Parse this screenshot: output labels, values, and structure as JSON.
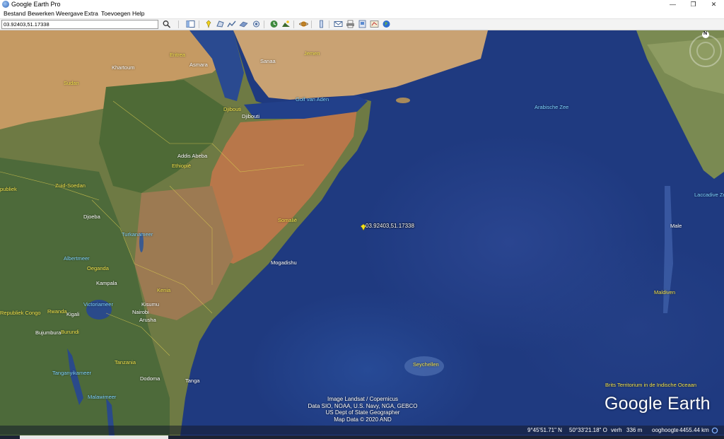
{
  "window": {
    "title": "Google Earth Pro",
    "minimize": "—",
    "maximize": "❐",
    "close": "✕"
  },
  "menu": [
    "Bestand",
    "Bewerken",
    "Weergave",
    "Extra",
    "Toevoegen",
    "Help"
  ],
  "search": {
    "value": "03.92403,51.17338"
  },
  "toolbar_icons": [
    "search-icon",
    "sidebar-toggle-icon",
    "placemark-icon",
    "polygon-icon",
    "path-icon",
    "image-overlay-icon",
    "record-tour-icon",
    "historical-imagery-icon",
    "sunlight-icon",
    "planets-icon",
    "ruler-icon",
    "email-icon",
    "print-icon",
    "save-image-icon",
    "view-in-maps-icon",
    "earth-icon"
  ],
  "map": {
    "placemark": {
      "label": "03.92403,51.17338"
    },
    "countries": [
      {
        "key": "sudan",
        "text": "Sudan"
      },
      {
        "key": "eritrea",
        "text": "Eritrea"
      },
      {
        "key": "jemen",
        "text": "Jemen"
      },
      {
        "key": "djibouti",
        "text": "Djibouti"
      },
      {
        "key": "ethiopie",
        "text": "Ethiopië"
      },
      {
        "key": "zuid_soedan",
        "text": "Zuid-Soedan"
      },
      {
        "key": "somalie",
        "text": "Somalië"
      },
      {
        "key": "oeganda",
        "text": "Oeganda"
      },
      {
        "key": "kenia",
        "text": "Kenia"
      },
      {
        "key": "rwanda",
        "text": "Rwanda"
      },
      {
        "key": "burundi",
        "text": "Burundi"
      },
      {
        "key": "tanzania",
        "text": "Tanzania"
      },
      {
        "key": "seychellen",
        "text": "Seychellen"
      },
      {
        "key": "malediven",
        "text": "Maldiven"
      },
      {
        "key": "rep_congo",
        "text": "Republiek Congo"
      },
      {
        "key": "zuid_left",
        "text": "publiek"
      }
    ],
    "cities": [
      {
        "key": "khartoum",
        "text": "Khartoum"
      },
      {
        "key": "asmara",
        "text": "Asmara"
      },
      {
        "key": "sanaa",
        "text": "Sanaa"
      },
      {
        "key": "djibouti_city",
        "text": "Djibouti"
      },
      {
        "key": "addis",
        "text": "Addis Abeba"
      },
      {
        "key": "juba",
        "text": "Djoeba"
      },
      {
        "key": "mogadishu",
        "text": "Mogadishu"
      },
      {
        "key": "kampala",
        "text": "Kampala"
      },
      {
        "key": "kigali",
        "text": "Kigali"
      },
      {
        "key": "nairobi",
        "text": "Nairobi"
      },
      {
        "key": "bujumbura",
        "text": "Bujumbura"
      },
      {
        "key": "dodoma",
        "text": "Dodoma"
      },
      {
        "key": "male",
        "text": "Male"
      },
      {
        "key": "kisumu",
        "text": "Kisumu"
      },
      {
        "key": "arusha",
        "text": "Arusha"
      },
      {
        "key": "tanga",
        "text": "Tanga"
      }
    ],
    "waters": [
      {
        "key": "golf_aden",
        "text": "Golf van Aden"
      },
      {
        "key": "arabische_zee",
        "text": "Arabische Zee"
      },
      {
        "key": "turkana",
        "text": "Turkanameer"
      },
      {
        "key": "victoria",
        "text": "Victoriameer"
      },
      {
        "key": "albert",
        "text": "Albertmeer"
      },
      {
        "key": "tanganyika",
        "text": "Tanganyikameer"
      },
      {
        "key": "malawi",
        "text": "Malawimeer"
      },
      {
        "key": "laccadive",
        "text": "Laccadive Zee"
      }
    ],
    "regions": [
      {
        "key": "biot",
        "text": "Brits Territorium in de Indische Oceaan"
      }
    ],
    "attribution": [
      "Image Landsat / Copernicus",
      "Data SIO, NOAA, U.S. Navy, NGA, GEBCO",
      "US Dept of State Geographer",
      "Map Data © 2020 AND"
    ],
    "logo": "Google Earth",
    "compass_letter": "N"
  },
  "status": {
    "lat": "9°45'51.71\" N",
    "lon": "50°33'21.18\" O",
    "elev_label": "verh",
    "elev": "336 m",
    "eye_label": "ooghoogte",
    "eye": "4455.44 km"
  },
  "colors": {
    "ocean": "#1f3a80",
    "land_desert": "#b98a5a",
    "land_green": "#4d6a3a",
    "label_country": "#f3e24a",
    "label_water": "#7fd3ff"
  }
}
